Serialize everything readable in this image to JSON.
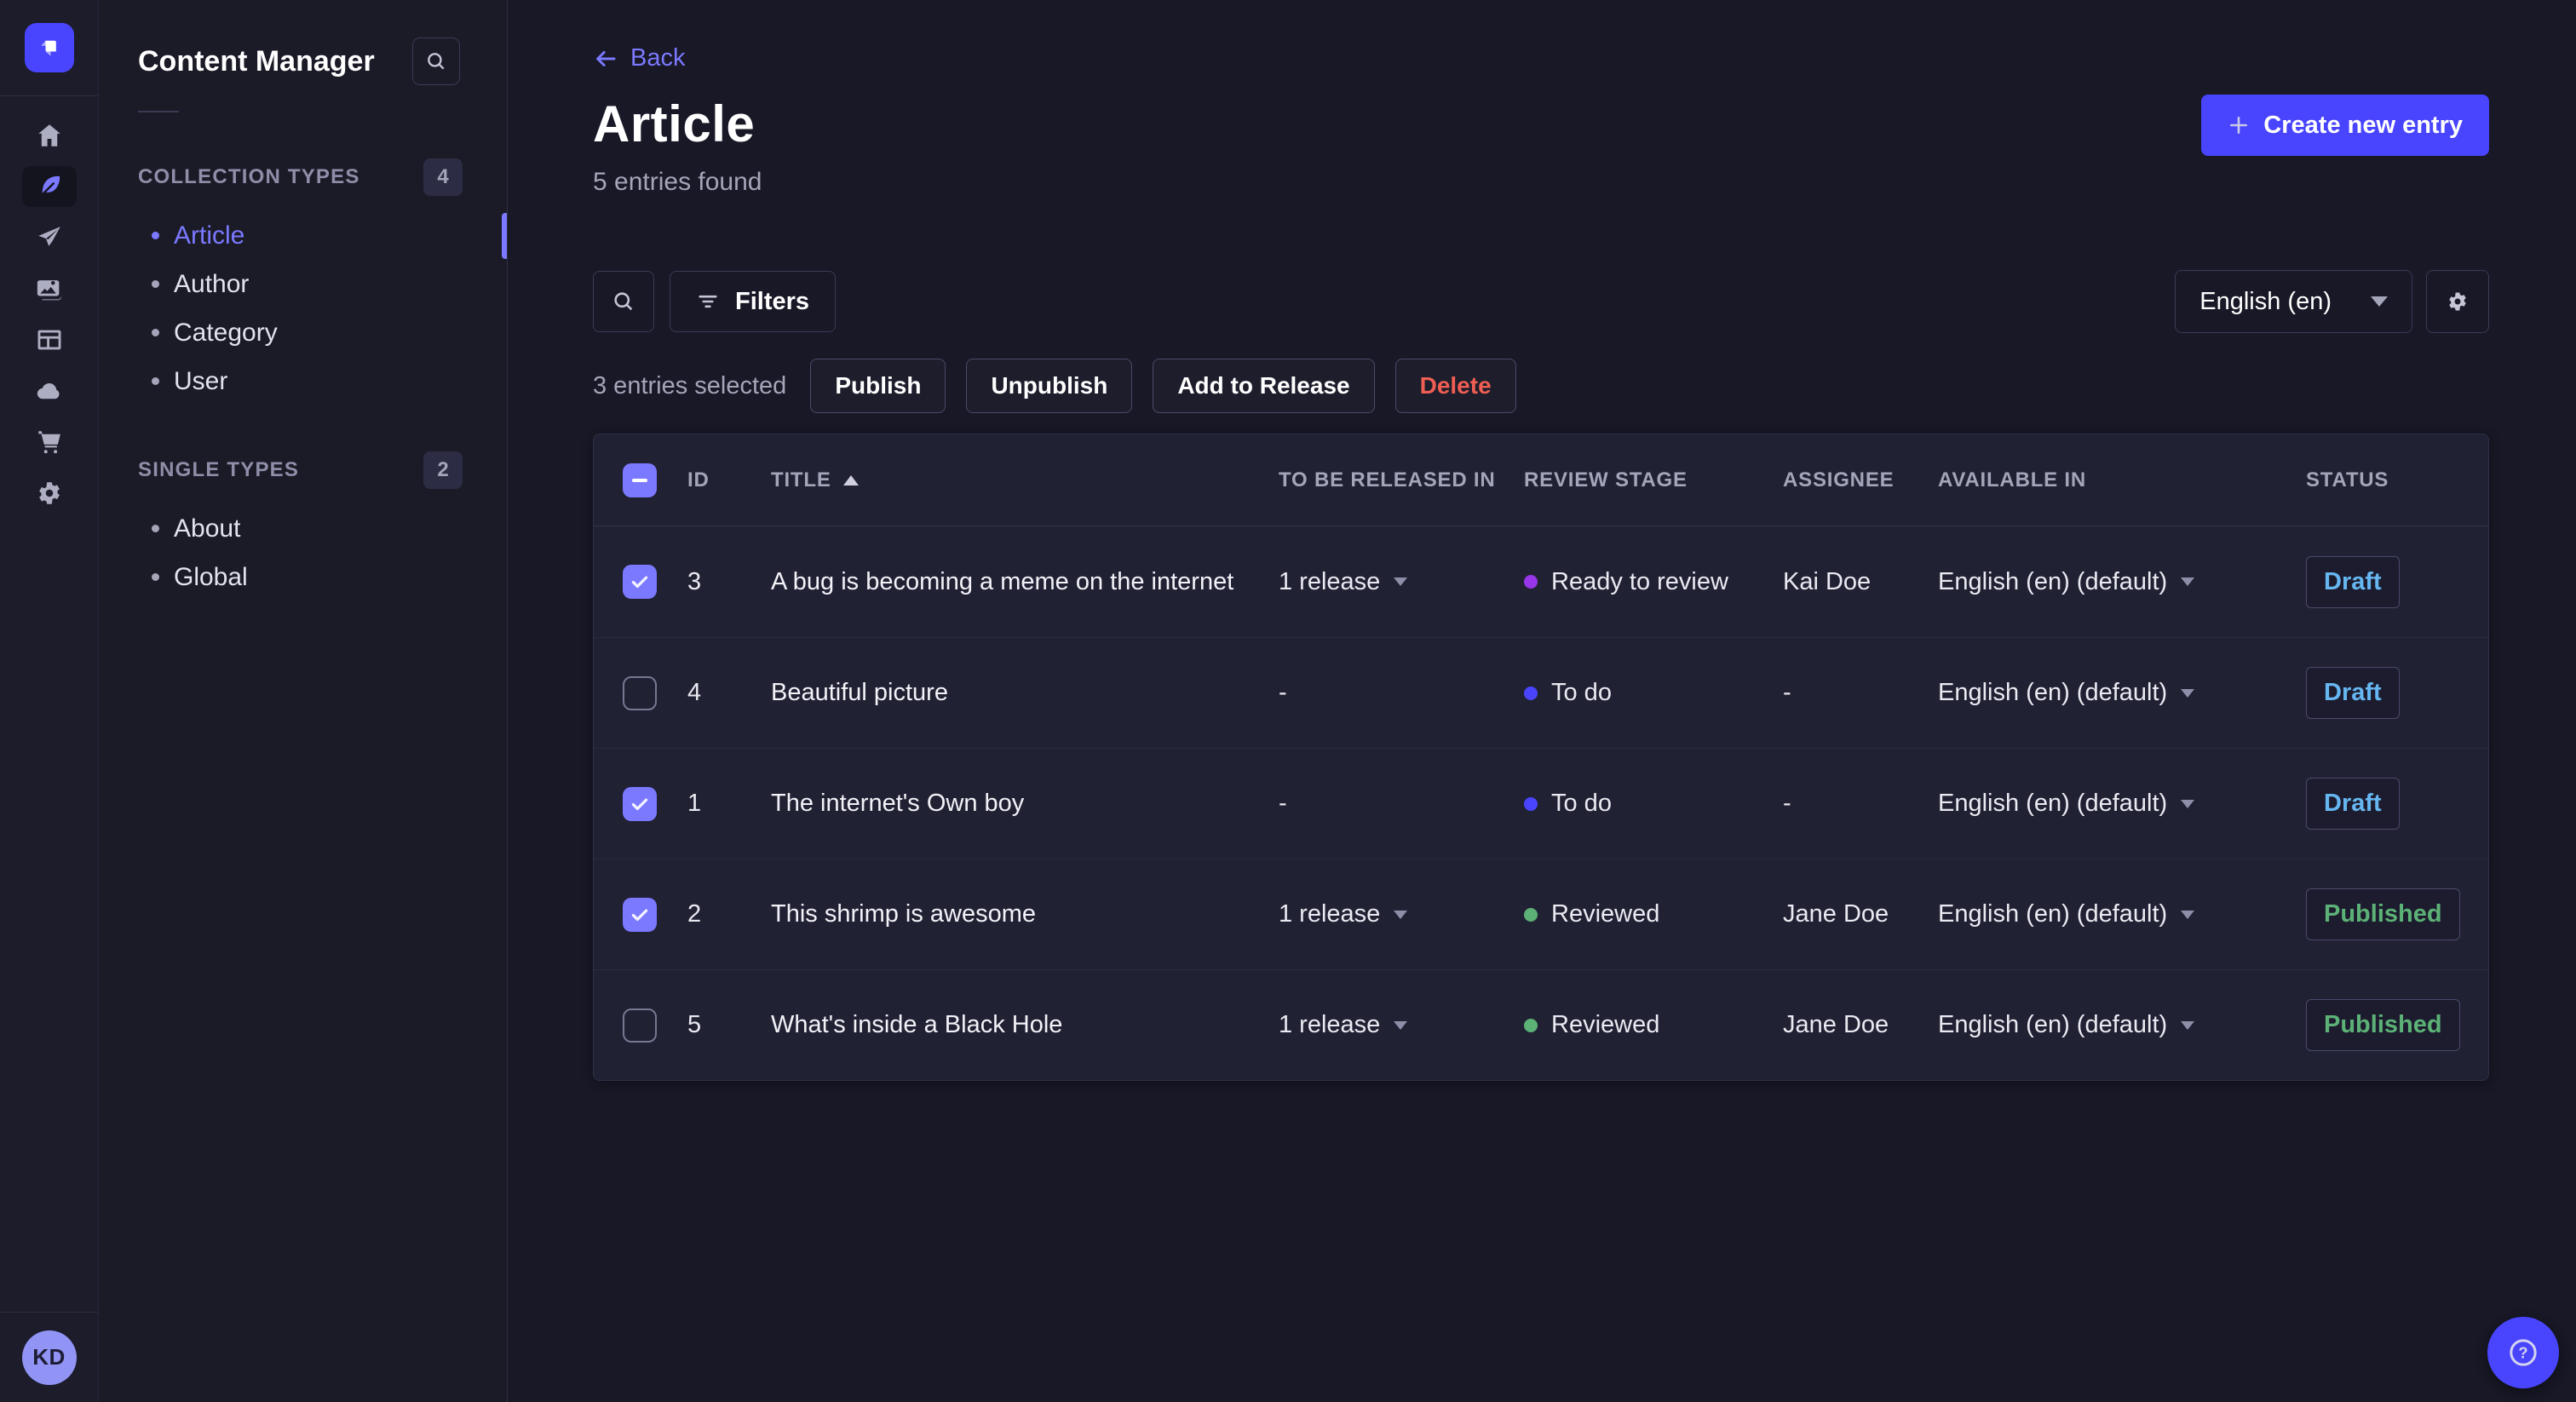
{
  "rail": {
    "icons": [
      "home-icon",
      "content-manager-feather-icon",
      "releases-paper-plane-icon",
      "media-library-images-icon",
      "content-type-builder-layout-icon",
      "cloud-icon",
      "marketplace-cart-icon",
      "settings-gear-icon"
    ],
    "active_icon": "content-manager-feather-icon",
    "user_initials": "KD"
  },
  "subnav": {
    "title": "Content Manager",
    "collection_types": {
      "label": "COLLECTION TYPES",
      "count": "4",
      "items": [
        {
          "label": "Article",
          "active": true
        },
        {
          "label": "Author",
          "active": false
        },
        {
          "label": "Category",
          "active": false
        },
        {
          "label": "User",
          "active": false
        }
      ]
    },
    "single_types": {
      "label": "SINGLE TYPES",
      "count": "2",
      "items": [
        {
          "label": "About",
          "active": false
        },
        {
          "label": "Global",
          "active": false
        }
      ]
    }
  },
  "header": {
    "back_label": "Back",
    "title": "Article",
    "subtitle": "5 entries found",
    "create_button_label": "Create new entry"
  },
  "toolbar": {
    "filters_label": "Filters",
    "locale_value": "English (en)"
  },
  "selection": {
    "summary": "3 entries selected",
    "actions": [
      {
        "label": "Publish",
        "variant": "default"
      },
      {
        "label": "Unpublish",
        "variant": "default"
      },
      {
        "label": "Add to Release",
        "variant": "default"
      },
      {
        "label": "Delete",
        "variant": "danger"
      }
    ]
  },
  "table": {
    "columns": [
      {
        "key": "id",
        "label": "ID"
      },
      {
        "key": "title",
        "label": "TITLE",
        "sorted": "asc"
      },
      {
        "key": "released",
        "label": "TO BE RELEASED IN"
      },
      {
        "key": "review",
        "label": "REVIEW STAGE"
      },
      {
        "key": "assignee",
        "label": "ASSIGNEE"
      },
      {
        "key": "available",
        "label": "AVAILABLE IN"
      },
      {
        "key": "status",
        "label": "STATUS"
      }
    ],
    "rows": [
      {
        "selected": true,
        "id": "3",
        "title": "A bug is becoming a meme on the internet",
        "release": "1 release",
        "review_stage": "Ready to review",
        "review_color": "#9736e8",
        "assignee": "Kai Doe",
        "available_in": "English (en) (default)",
        "status": "Draft"
      },
      {
        "selected": false,
        "id": "4",
        "title": "Beautiful picture",
        "release": "-",
        "review_stage": "To do",
        "review_color": "#4945ff",
        "assignee": "-",
        "available_in": "English (en) (default)",
        "status": "Draft"
      },
      {
        "selected": true,
        "id": "1",
        "title": "The internet's Own boy",
        "release": "-",
        "review_stage": "To do",
        "review_color": "#4945ff",
        "assignee": "-",
        "available_in": "English (en) (default)",
        "status": "Draft"
      },
      {
        "selected": true,
        "id": "2",
        "title": "This shrimp is awesome",
        "release": "1 release",
        "review_stage": "Reviewed",
        "review_color": "#5cb176",
        "assignee": "Jane Doe",
        "available_in": "English (en) (default)",
        "status": "Published"
      },
      {
        "selected": false,
        "id": "5",
        "title": "What's inside a Black Hole",
        "release": "1 release",
        "review_stage": "Reviewed",
        "review_color": "#5cb176",
        "assignee": "Jane Doe",
        "available_in": "English (en) (default)",
        "status": "Published"
      }
    ]
  },
  "colors": {
    "primary": "#4945ff",
    "link": "#7b79ff",
    "draft": "#66b7f1",
    "published": "#5cb176",
    "danger": "#ee5e52"
  }
}
